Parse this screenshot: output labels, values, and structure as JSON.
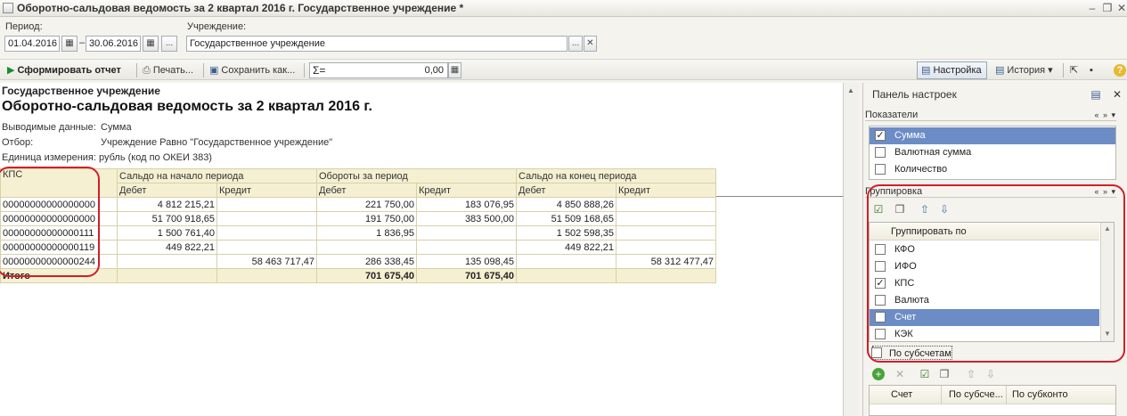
{
  "window": {
    "title": "Оборотно-сальдовая ведомость за 2 квартал 2016 г. Государственное учреждение *"
  },
  "filters": {
    "period_label": "Период:",
    "period_from": "01.04.2016",
    "period_sep": "–",
    "period_to": "30.06.2016",
    "ellipsis": "...",
    "institution_label": "Учреждение:",
    "institution_value": "Государственное учреждение"
  },
  "toolbar": {
    "generate": "Сформировать отчет",
    "print": "Печать...",
    "save": "Сохранить как...",
    "sum_symbol": "Σ=",
    "sum_value": "0,00",
    "settings": "Настройка",
    "history": "История"
  },
  "report": {
    "org": "Государственное учреждение",
    "title": "Оборотно-сальдовая ведомость за 2 квартал 2016 г.",
    "meta": [
      {
        "label": "Выводимые данные:",
        "value": "Сумма"
      },
      {
        "label": "Отбор:",
        "value": "Учреждение Равно \"Государственное учреждение\""
      },
      {
        "label": "Единица измерения: рубль (код по ОКЕИ 383)",
        "value": ""
      }
    ],
    "headers": {
      "kps": "КПС",
      "opening": "Сальдо на начало периода",
      "turnover": "Обороты за период",
      "closing": "Сальдо на конец периода",
      "debit": "Дебет",
      "credit": "Кредит"
    },
    "rows": [
      {
        "kps": "00000000000000000",
        "od": "4 812 215,21",
        "oc": "",
        "td": "221 750,00",
        "tc": "183 076,95",
        "cd": "4 850 888,26",
        "cc": ""
      },
      {
        "kps": "00000000000000000",
        "od": "51 700 918,65",
        "oc": "",
        "td": "191 750,00",
        "tc": "383 500,00",
        "cd": "51 509 168,65",
        "cc": ""
      },
      {
        "kps": "00000000000000111",
        "od": "1 500 761,40",
        "oc": "",
        "td": "1 836,95",
        "tc": "",
        "cd": "1 502 598,35",
        "cc": ""
      },
      {
        "kps": "00000000000000119",
        "od": "449 822,21",
        "oc": "",
        "td": "",
        "tc": "",
        "cd": "449 822,21",
        "cc": ""
      },
      {
        "kps": "00000000000000244",
        "od": "",
        "oc": "58 463 717,47",
        "td": "286 338,45",
        "tc": "135 098,45",
        "cd": "",
        "cc": "58 312 477,47"
      }
    ],
    "total": {
      "label": "Итого",
      "td": "701 675,40",
      "tc": "701 675,40"
    }
  },
  "panel": {
    "title": "Панель настроек",
    "indicators_label": "Показатели",
    "indicators": [
      {
        "label": "Сумма",
        "checked": true,
        "selected": true
      },
      {
        "label": "Валютная сумма",
        "checked": false,
        "selected": false
      },
      {
        "label": "Количество",
        "checked": false,
        "selected": false
      }
    ],
    "grouping_label": "Группировка",
    "group_by_header": "Группировать по",
    "groupings": [
      {
        "label": "КФО",
        "checked": false,
        "selected": false
      },
      {
        "label": "ИФО",
        "checked": false,
        "selected": false
      },
      {
        "label": "КПС",
        "checked": true,
        "selected": false
      },
      {
        "label": "Валюта",
        "checked": false,
        "selected": false
      },
      {
        "label": "Счет",
        "checked": false,
        "selected": true
      },
      {
        "label": "КЭК",
        "checked": false,
        "selected": false
      }
    ],
    "by_subaccounts": "По субсчетам",
    "bottom_columns": [
      "Счет",
      "По субсче...",
      "По субконто"
    ]
  },
  "colors": {
    "selection": "#6c8cc6",
    "highlight_red": "#d21e2a",
    "header_fill": "#f5f0d2"
  }
}
